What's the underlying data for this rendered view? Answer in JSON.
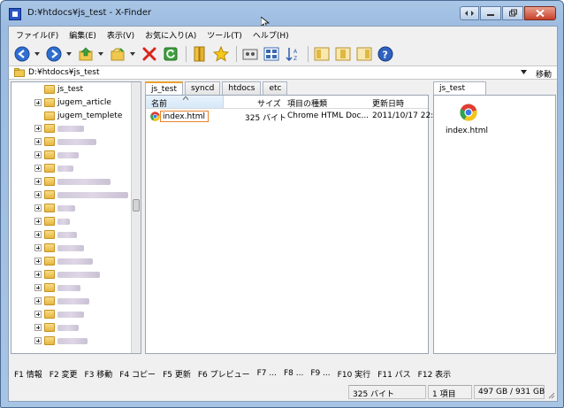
{
  "window": {
    "title": "D:¥htdocs¥js_test - X-Finder"
  },
  "menubar": {
    "items": [
      "ファイル(F)",
      "編集(E)",
      "表示(V)",
      "お気に入り(A)",
      "ツール(T)",
      "ヘルプ(H)"
    ]
  },
  "toolbar": {
    "icons": [
      "back-icon",
      "forward-icon",
      "up-folder-icon",
      "new-folder-icon",
      "delete-icon",
      "refresh-icon",
      "bookmark-icon",
      "favorites-star-icon",
      "view-icon",
      "details-icon",
      "sort-icon",
      "pane-left-icon",
      "pane-center-icon",
      "pane-right-icon",
      "help-icon"
    ]
  },
  "address": {
    "path": "D:¥htdocs¥js_test",
    "go_label": "移動"
  },
  "tree": {
    "items": [
      {
        "label": "js_test",
        "expandable": false
      },
      {
        "label": "jugem_article",
        "expandable": true
      },
      {
        "label": "jugem_templete",
        "expandable": false
      }
    ]
  },
  "tabs": [
    "js_test",
    "syncd",
    "htdocs",
    "etc"
  ],
  "file_list": {
    "columns": [
      "名前",
      "サイズ",
      "項目の種類",
      "更新日時"
    ],
    "rows": [
      {
        "name": "index.html",
        "size": "325 バイト",
        "type": "Chrome HTML Doc...",
        "modified": "2011/10/17 22:"
      }
    ]
  },
  "preview": {
    "tab": "js_test",
    "file": "index.html"
  },
  "fkeys": [
    "F1 情報",
    "F2 変更",
    "F3 移動",
    "F4 コピー",
    "F5 更新",
    "F6 プレビュー",
    "F7 ...",
    "F8 ...",
    "F9 ...",
    "F10 実行",
    "F11 パス",
    "F12 表示"
  ],
  "status": {
    "size": "325 バイト",
    "count": "1 項目",
    "disk": "497 GB / 931 GB"
  }
}
